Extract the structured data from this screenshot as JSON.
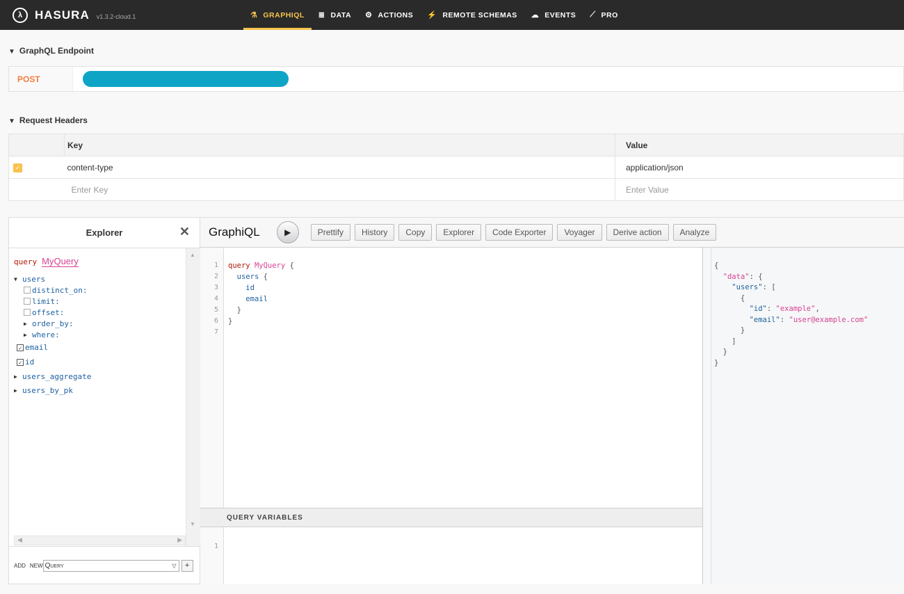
{
  "nav": {
    "brand": "HASURA",
    "version": "v1.3.2-cloud.1",
    "tabs": [
      {
        "label": "GRAPHIQL",
        "icon": "flask-icon"
      },
      {
        "label": "DATA",
        "icon": "database-icon"
      },
      {
        "label": "ACTIONS",
        "icon": "cogs-icon"
      },
      {
        "label": "REMOTE SCHEMAS",
        "icon": "plug-icon"
      },
      {
        "label": "EVENTS",
        "icon": "cloud-icon"
      },
      {
        "label": "PRO",
        "icon": "chart-line-icon"
      }
    ]
  },
  "endpoint": {
    "title": "GraphQL Endpoint",
    "method": "POST"
  },
  "headers": {
    "title": "Request Headers",
    "col_key": "Key",
    "col_value": "Value",
    "rows": [
      {
        "key": "content-type",
        "value": "application/json",
        "checked": true
      }
    ],
    "key_placeholder": "Enter Key",
    "value_placeholder": "Enter Value"
  },
  "explorer": {
    "title": "Explorer",
    "query_keyword": "query",
    "query_name": "MyQuery",
    "tree": {
      "users": "users",
      "args": [
        "distinct_on:",
        "limit:",
        "offset:"
      ],
      "nested_args": [
        "order_by:",
        "where:"
      ],
      "fields": [
        "email",
        "id"
      ],
      "others": [
        "users_aggregate",
        "users_by_pk"
      ]
    },
    "footer_add": "ADD",
    "footer_new": "NEW",
    "footer_select": "Query",
    "footer_plus": "+"
  },
  "graphiql": {
    "title": "GraphiQL",
    "buttons": [
      "Prettify",
      "History",
      "Copy",
      "Explorer",
      "Code Exporter",
      "Voyager",
      "Derive action",
      "Analyze"
    ],
    "query_variables_label": "QUERY VARIABLES"
  },
  "editor": {
    "lines": [
      {
        "n": "1",
        "parts": [
          [
            "kw",
            "query "
          ],
          [
            "str",
            "MyQuery"
          ],
          [
            "pun",
            " {"
          ]
        ]
      },
      {
        "n": "2",
        "parts": [
          [
            "pun",
            "  "
          ],
          [
            "fld",
            "users"
          ],
          [
            "pun",
            " {"
          ]
        ]
      },
      {
        "n": "3",
        "parts": [
          [
            "pun",
            "    "
          ],
          [
            "fld",
            "id"
          ]
        ]
      },
      {
        "n": "4",
        "parts": [
          [
            "pun",
            "    "
          ],
          [
            "fld",
            "email"
          ]
        ]
      },
      {
        "n": "5",
        "parts": [
          [
            "pun",
            "  }"
          ]
        ]
      },
      {
        "n": "6",
        "parts": [
          [
            "pun",
            "}"
          ]
        ]
      },
      {
        "n": "7",
        "parts": []
      }
    ],
    "var_line": "1"
  },
  "result": {
    "lines": [
      [
        [
          "pun",
          "{"
        ]
      ],
      [
        [
          "pun",
          "  "
        ],
        [
          "str",
          "\"data\""
        ],
        [
          "pun",
          ": {"
        ]
      ],
      [
        [
          "pun",
          "    "
        ],
        [
          "key",
          "\"users\""
        ],
        [
          "pun",
          ": ["
        ]
      ],
      [
        [
          "pun",
          "      {"
        ]
      ],
      [
        [
          "pun",
          "        "
        ],
        [
          "key",
          "\"id\""
        ],
        [
          "pun",
          ": "
        ],
        [
          "str",
          "\"example\""
        ],
        [
          "pun",
          ","
        ]
      ],
      [
        [
          "pun",
          "        "
        ],
        [
          "key",
          "\"email\""
        ],
        [
          "pun",
          ": "
        ],
        [
          "str",
          "\"user@example.com\""
        ]
      ],
      [
        [
          "pun",
          "      }"
        ]
      ],
      [
        [
          "pun",
          "    ]"
        ]
      ],
      [
        [
          "pun",
          "  }"
        ]
      ],
      [
        [
          "pun",
          "}"
        ]
      ]
    ]
  }
}
